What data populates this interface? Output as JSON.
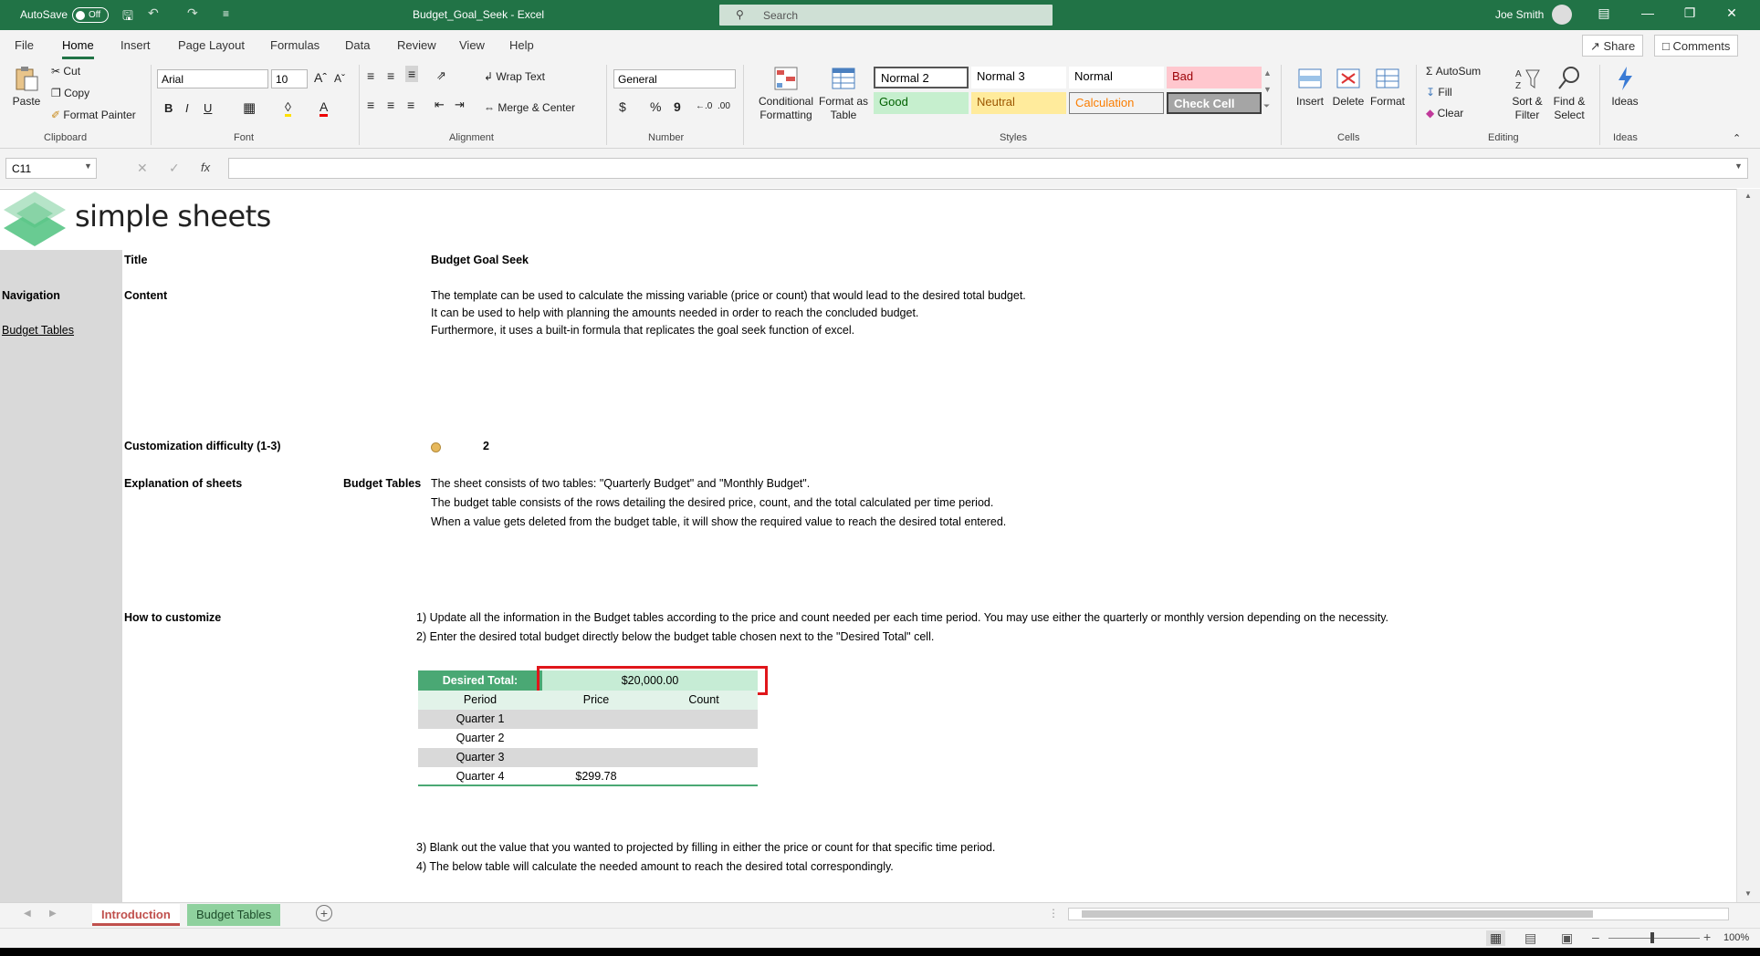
{
  "titlebar": {
    "autosave_label": "AutoSave",
    "autosave_state": "Off",
    "doc_title": "Budget_Goal_Seek  -  Excel",
    "search_placeholder": "Search",
    "user_name": "Joe Smith"
  },
  "menu": {
    "tabs": [
      "File",
      "Home",
      "Insert",
      "Page Layout",
      "Formulas",
      "Data",
      "Review",
      "View",
      "Help"
    ],
    "active_tab": "Home",
    "share_label": "Share",
    "comments_label": "Comments"
  },
  "ribbon": {
    "clipboard": {
      "paste": "Paste",
      "cut": "Cut",
      "copy": "Copy",
      "format_painter": "Format Painter",
      "label": "Clipboard"
    },
    "font": {
      "name": "Arial",
      "size": "10",
      "bold": "B",
      "italic": "I",
      "underline": "U",
      "label": "Font"
    },
    "alignment": {
      "wrap_text": "Wrap Text",
      "merge_center": "Merge & Center",
      "label": "Alignment"
    },
    "number": {
      "format": "General",
      "currency": "$",
      "percent": "%",
      "comma": "9",
      "label": "Number"
    },
    "styles": {
      "conditional": "Conditional Formatting",
      "format_table": "Format as Table",
      "cells": [
        "Normal 2",
        "Normal 3",
        "Normal",
        "Bad",
        "Good",
        "Neutral",
        "Calculation",
        "Check Cell"
      ],
      "label": "Styles"
    },
    "cells_grp": {
      "insert": "Insert",
      "delete": "Delete",
      "format": "Format",
      "label": "Cells"
    },
    "editing": {
      "autosum": "AutoSum",
      "fill": "Fill",
      "clear": "Clear",
      "sort_filter": "Sort & Filter",
      "find_select": "Find & Select",
      "label": "Editing"
    },
    "ideas": {
      "ideas": "Ideas",
      "label": "Ideas"
    }
  },
  "formula_bar": {
    "name_box": "C11",
    "fx": "fx",
    "value": ""
  },
  "sheet": {
    "logo_text": "simple sheets",
    "title_label": "Title",
    "title_value": "Budget Goal Seek",
    "navigation_label": "Navigation",
    "nav_link": "Budget Tables",
    "content_label": "Content",
    "content_lines": [
      "The template can be used to calculate the missing variable (price or count) that would lead to the desired total budget.",
      "It can be used to help with planning the amounts needed in order to reach the concluded budget.",
      "Furthermore, it uses a built-in formula that replicates the goal seek function of excel."
    ],
    "difficulty_label": "Customization difficulty (1-3)",
    "difficulty_value": "2",
    "explanation_label": "Explanation of sheets",
    "explanation_sheet": "Budget Tables",
    "explanation_lines": [
      "The sheet consists of two tables: \"Quarterly Budget\" and \"Monthly Budget\".",
      "The budget table consists of the rows detailing the desired price, count, and the total calculated per time period.",
      "When a value gets deleted from the budget table, it will show the required value to reach the desired total entered."
    ],
    "customize_label": "How to customize",
    "customize_steps_a": [
      "1) Update all the information in the Budget tables according to the price and count needed per each time period. You may use either the quarterly or monthly version depending on the necessity.",
      "2) Enter the desired total budget directly below the budget table chosen next to the \"Desired Total\" cell."
    ],
    "customize_steps_b": [
      "3) Blank out the value that you wanted to projected by filling in either the price or count for that specific time period.",
      "4) The below table will calculate the needed amount to reach the desired total correspondingly."
    ],
    "budget_table": {
      "desired_label": "Desired Total:",
      "desired_value": "$20,000.00",
      "headers": [
        "Period",
        "Price",
        "Count"
      ],
      "rows": [
        [
          "Quarter 1",
          "",
          ""
        ],
        [
          "Quarter 2",
          "",
          ""
        ],
        [
          "Quarter 3",
          "",
          ""
        ],
        [
          "Quarter 4",
          "$299.78",
          ""
        ]
      ]
    }
  },
  "sheet_tabs": {
    "tabs": [
      "Introduction",
      "Budget Tables"
    ],
    "active": "Introduction"
  },
  "status": {
    "zoom": "100%"
  },
  "colors": {
    "excel_green": "#217346",
    "table_green": "#4aa874",
    "highlight_red": "#e0161b",
    "nav_gray": "#d9d9d9"
  }
}
